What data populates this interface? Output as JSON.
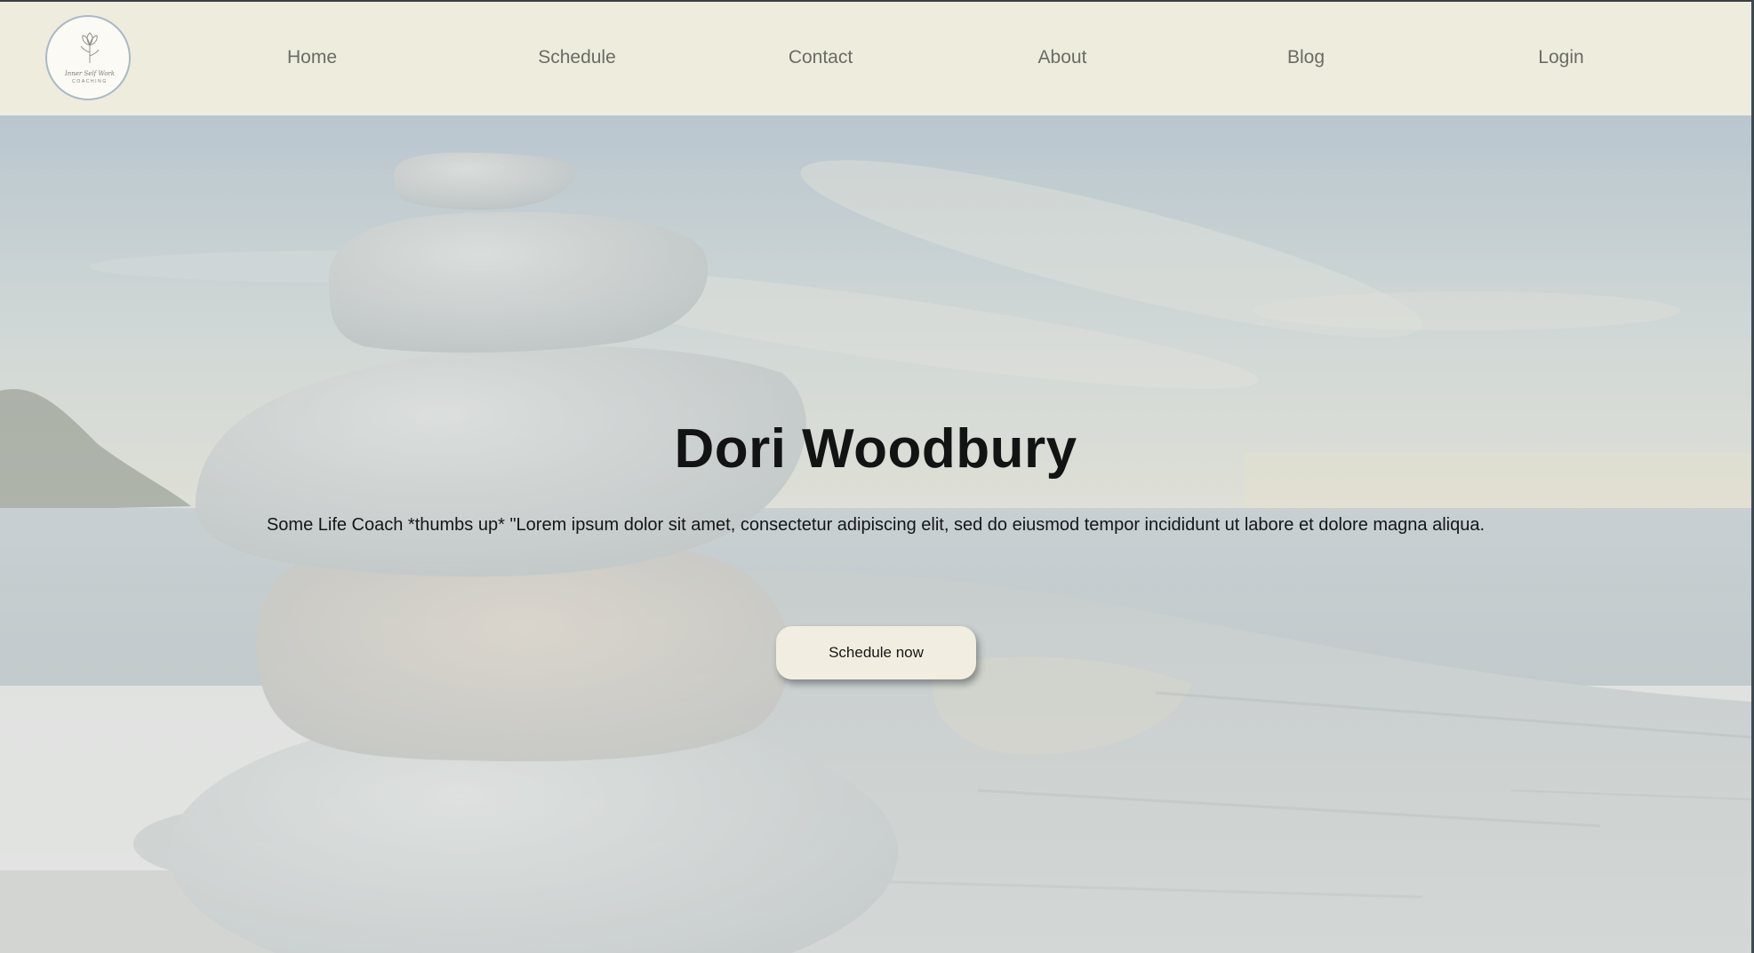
{
  "header": {
    "logo": {
      "script_text": "Inner Self Work",
      "caption": "COACHING"
    },
    "nav": [
      {
        "label": "Home"
      },
      {
        "label": "Schedule"
      },
      {
        "label": "Contact"
      },
      {
        "label": "About"
      },
      {
        "label": "Blog"
      },
      {
        "label": "Login"
      }
    ]
  },
  "hero": {
    "title": "Dori Woodbury",
    "subtitle": "Some Life Coach *thumbs up* \"Lorem ipsum dolor sit amet, consectetur adipiscing elit, sed do eiusmod tempor incididunt ut labore et dolore magna aliqua.",
    "cta_label": "Schedule now",
    "background": "stacked-stones-on-beach-image"
  },
  "colors": {
    "navbar_bg": "#eeecdc",
    "nav_text": "#6a6b66",
    "cta_bg": "#f1eee1",
    "title_text": "#121414"
  }
}
